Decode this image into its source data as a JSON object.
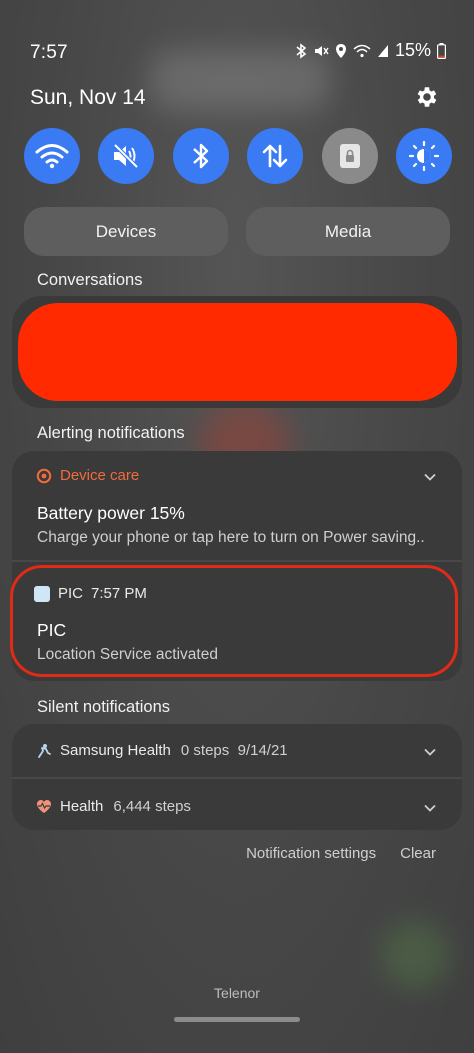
{
  "status_bar": {
    "time": "7:57",
    "battery": "15%",
    "icons": [
      "bluetooth-icon",
      "mute-icon",
      "location-icon",
      "wifi-signal-icon",
      "cell-signal-icon",
      "battery-icon"
    ]
  },
  "header": {
    "date": "Sun, Nov 14",
    "settings_icon": "gear-icon"
  },
  "quick_toggles": [
    {
      "name": "wifi",
      "icon": "wifi-icon",
      "active": true
    },
    {
      "name": "mute",
      "icon": "mute-icon",
      "active": true
    },
    {
      "name": "bluetooth",
      "icon": "bluetooth-icon",
      "active": true
    },
    {
      "name": "mobile-data",
      "icon": "data-arrows-icon",
      "active": true
    },
    {
      "name": "lock-rotation",
      "icon": "lock-icon",
      "active": false
    },
    {
      "name": "brightness",
      "icon": "brightness-icon",
      "active": true
    }
  ],
  "buttons": {
    "devices": "Devices",
    "media": "Media"
  },
  "sections": {
    "conversations": "Conversations",
    "alerting": "Alerting notifications",
    "silent": "Silent notifications"
  },
  "alerting": {
    "device_care": {
      "app": "Device care",
      "title": "Battery power 15%",
      "body": "Charge your phone or tap here to turn on Power saving.."
    },
    "pic": {
      "app": "PIC",
      "time": "7:57 PM",
      "title": "PIC",
      "body": "Location Service activated"
    }
  },
  "silent": [
    {
      "app": "Samsung Health",
      "meta": "0 steps  9/14/21"
    },
    {
      "app": "Health",
      "meta": "6,444 steps"
    }
  ],
  "footer": {
    "notification_settings": "Notification settings",
    "clear": "Clear",
    "carrier": "Telenor"
  },
  "colors": {
    "toggle_active": "#3a7af2",
    "toggle_inactive": "#8a8a8a",
    "device_care_accent": "#f26b3a",
    "redaction": "#ff2a00",
    "highlight": "#e12a18"
  }
}
